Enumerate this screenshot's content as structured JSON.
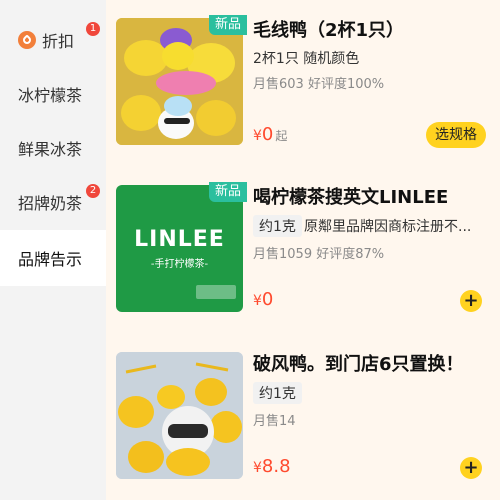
{
  "sidebar": {
    "items": [
      {
        "label": "折扣",
        "badge": "1"
      },
      {
        "label": "冰柠檬茶"
      },
      {
        "label": "鲜果冰茶"
      },
      {
        "label": "招牌奶茶",
        "badge": "2"
      },
      {
        "label": "品牌告示"
      }
    ]
  },
  "products": [
    {
      "tag": "新品",
      "title": "毛线鸭（2杯1只）",
      "desc": "2杯1只 随机颜色",
      "sales": "月售603  好评度100%",
      "price_symbol": "¥",
      "price": "0",
      "price_suffix": "起",
      "button": "选规格"
    },
    {
      "tag": "新品",
      "title": "喝柠檬茶搜英文LINLEE",
      "spec": "约1克",
      "desc": "原鄰里品牌因商标注册不...",
      "sales": "月售1059  好评度87%",
      "price_symbol": "¥",
      "price": "0",
      "logo_text": "LINLEE",
      "logo_sub": "-手打柠檬茶-",
      "plus": "+"
    },
    {
      "title": "破风鸭。到门店6只置换！",
      "spec": "约1克",
      "sales": "月售14",
      "price_symbol": "¥",
      "price": "8.8",
      "plus": "+"
    }
  ],
  "colors": {
    "accent": "#ffd21f",
    "price": "#ff4a2e",
    "new_tag": "#2bbf9e",
    "linlee_green": "#1f9a45"
  }
}
